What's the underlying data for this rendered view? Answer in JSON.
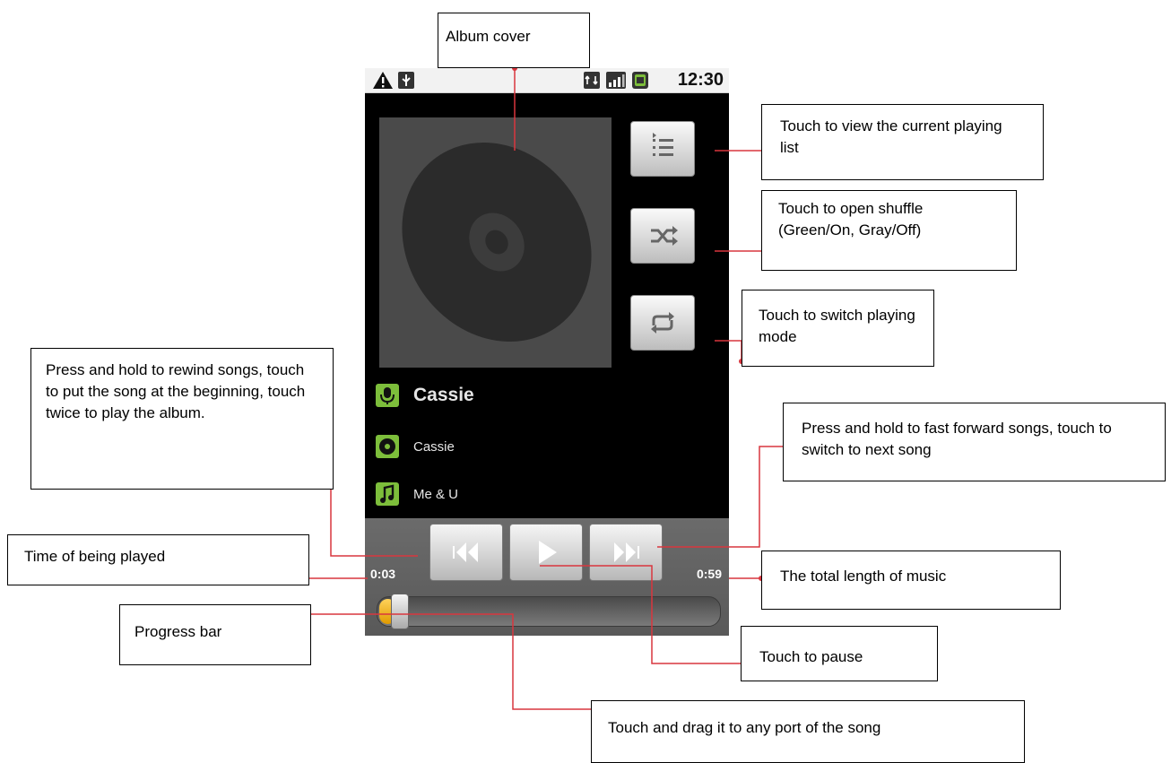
{
  "status_bar": {
    "time": "12:30",
    "icons": [
      "warning-icon",
      "usb-icon",
      "data-icon",
      "signal-icon",
      "battery-icon"
    ]
  },
  "player": {
    "album_art_icon": "disc-icon",
    "side_buttons": [
      "playlist-icon",
      "shuffle-icon",
      "repeat-icon"
    ],
    "artist": "Cassie",
    "album": "Cassie",
    "song": "Me & U",
    "elapsed": "0:03",
    "total": "0:59",
    "progress": 0.05,
    "controls": [
      "rewind-icon",
      "play-icon",
      "fast-forward-icon"
    ]
  },
  "callouts": {
    "album_cover": "Album cover",
    "playlist": "Touch to view the current playing list",
    "shuffle_line1": "Touch to open shuffle",
    "shuffle_line2": "(Green/On, Gray/Off)",
    "repeat": "Touch to switch playing mode",
    "rewind": "Press and hold to rewind songs, touch to put the song at the beginning, touch twice to play the album.",
    "forward": "Press and hold to fast forward songs, touch to switch to next song",
    "time_played": "Time of being played",
    "total_length": "The total length of music",
    "progress_bar": "Progress bar",
    "pause": "Touch to pause",
    "drag": "Touch and drag it to any port of the song"
  },
  "colors": {
    "accent_green": "#7dbe3b",
    "leader_red": "#d9363e",
    "progress_orange": "#f0b020"
  }
}
